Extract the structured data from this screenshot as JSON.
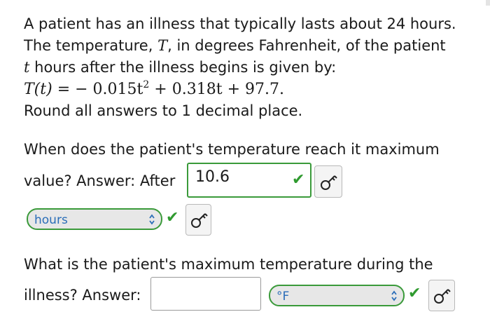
{
  "problem": {
    "line1": "A patient has an illness that typically lasts about 24 hours.",
    "line2_prefix": "The temperature, ",
    "line2_var": "T",
    "line2_suffix": ", in degrees Fahrenheit, of the patient",
    "line3_var": "t",
    "line3_suffix": " hours after the illness begins is given by:",
    "equation": {
      "lhs": "T(t)",
      "equals": "=",
      "term1": "− 0.015t",
      "exponent": "2",
      "plus1": "+",
      "term2": "0.318t",
      "plus2": "+",
      "term3": "97.7."
    },
    "rounding_note": "Round all answers to 1 decimal place."
  },
  "question1": {
    "text_line1": "When does the patient's temperature reach it maximum",
    "text_line2": "value? Answer: After",
    "answer_value": "10.6",
    "answer_status": "correct",
    "unit_selected": "hours",
    "unit_status": "correct",
    "check_icon": "check-mark-icon",
    "key_icon": "key-icon"
  },
  "question2": {
    "text_line1": "What is the patient's maximum temperature during the",
    "text_line2": "illness? Answer:",
    "answer_value": "",
    "unit_selected": "°F",
    "unit_status": "correct",
    "check_icon": "check-mark-icon",
    "key_icon": "key-icon"
  },
  "colors": {
    "correct_green": "#3a9a3a",
    "select_text_blue": "#2a6db8",
    "button_gray": "#f4f4f4"
  }
}
